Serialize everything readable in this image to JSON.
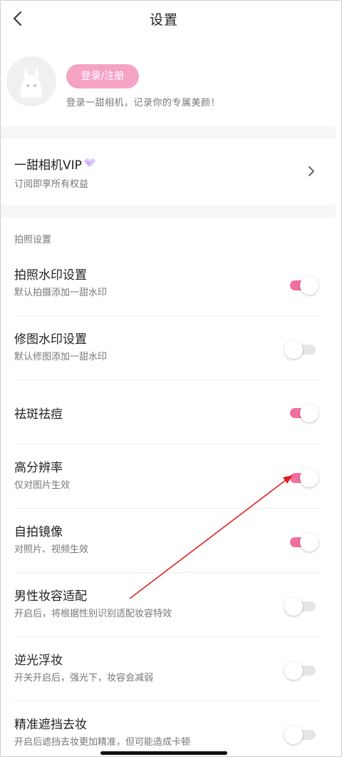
{
  "header": {
    "title": "设置"
  },
  "profile": {
    "login_label": "登录/注册",
    "hint": "登录一甜相机，记录你的专属美颜！"
  },
  "vip": {
    "title": "一甜相机VIP",
    "subtitle": "订阅即享所有权益"
  },
  "section": {
    "label": "拍照设置"
  },
  "settings": [
    {
      "title": "拍照水印设置",
      "subtitle": "默认拍摄添加一甜水印",
      "on": true
    },
    {
      "title": "修图水印设置",
      "subtitle": "默认修图添加一甜水印",
      "on": false
    },
    {
      "title": "祛斑祛痘",
      "subtitle": "",
      "on": true
    },
    {
      "title": "高分辨率",
      "subtitle": "仅对图片生效",
      "on": true
    },
    {
      "title": "自拍镜像",
      "subtitle": "对照片、视频生效",
      "on": true
    },
    {
      "title": "男性妆容适配",
      "subtitle": "开启后，将根据性别识别适配妆容特效",
      "on": false
    },
    {
      "title": "逆光浮妆",
      "subtitle": "开关开启后，强光下，妆容会减弱",
      "on": false
    },
    {
      "title": "精准遮挡去妆",
      "subtitle": "开启后遮挡去妆更加精准，但可能造成卡顿",
      "on": false
    }
  ],
  "colors": {
    "accent": "#f06fa0",
    "login_button": "#f5a3c4",
    "annotation_arrow": "#e02020"
  },
  "icons": {
    "back": "chevron-left-icon",
    "vip_badge": "gem-icon",
    "vip_more": "chevron-right-icon"
  }
}
